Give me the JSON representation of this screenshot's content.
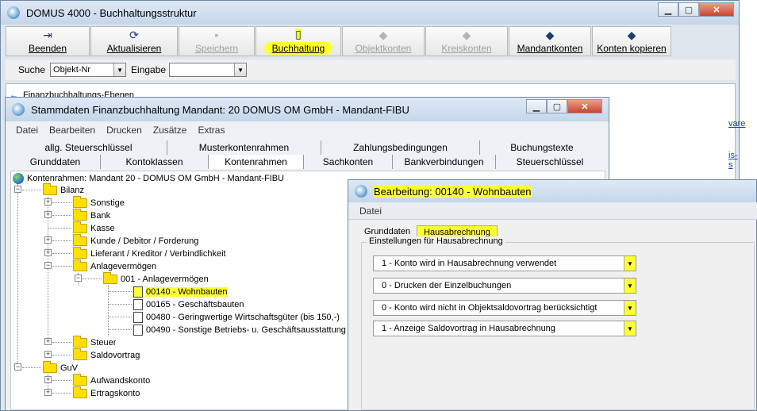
{
  "main": {
    "title": "DOMUS 4000 - Buchhaltungsstruktur",
    "toolbar": [
      {
        "label": "Beenden",
        "icon": "exit-icon",
        "glyph": "⇥"
      },
      {
        "label": "Aktualisieren",
        "icon": "refresh-icon",
        "glyph": "⟳"
      },
      {
        "label": "Speichern",
        "icon": "save-icon",
        "glyph": "▪"
      },
      {
        "label": "Buchhaltung",
        "icon": "book-icon",
        "glyph": "▯"
      },
      {
        "label": "Objektkonten",
        "icon": "eraser-icon",
        "glyph": "◆"
      },
      {
        "label": "Kreiskonten",
        "icon": "eraser-icon",
        "glyph": "◆"
      },
      {
        "label": "Mandantkonten",
        "icon": "eraser-icon",
        "glyph": "◆"
      },
      {
        "label": "Konten kopieren",
        "icon": "eraser-icon",
        "glyph": "◆"
      }
    ],
    "search": {
      "label": "Suche",
      "value": "Objekt-Nr",
      "input_label": "Eingabe",
      "input_value": ""
    },
    "behind_text": "Finanzbuchhaltungs-Ebenen",
    "right_links": [
      "vare",
      "is-s"
    ]
  },
  "stamm": {
    "title": "Stammdaten Finanzbuchhaltung Mandant: 20  DOMUS OM GmbH - Mandant-FIBU",
    "menu": [
      "Datei",
      "Bearbeiten",
      "Drucken",
      "Zusätze",
      "Extras"
    ],
    "tabs_row1": [
      "allg. Steuerschlüssel",
      "Musterkontenrahmen",
      "Zahlungsbedingungen",
      "Buchungstexte"
    ],
    "tabs_row2": [
      "Grunddaten",
      "Kontoklassen",
      "Kontenrahmen",
      "Sachkonten",
      "Bankverbindungen",
      "Steuerschlüssel"
    ],
    "tree": {
      "root": "Kontenrahmen: Mandant 20 - DOMUS OM GmbH - Mandant-FIBU",
      "bilanz": "Bilanz",
      "b_items": [
        "Sonstige",
        "Bank",
        "Kasse",
        "Kunde / Debitor / Forderung",
        "Lieferant / Kreditor / Verbindlichkeit",
        "Anlagevermögen"
      ],
      "sub": "001 - Anlagevermögen",
      "accounts": [
        "00140 - Wohnbauten",
        "00165 - Geschäftsbauten",
        "00480 - Geringwertige Wirtschaftsgüter (bis 150,-)",
        "00490 - Sonstige Betriebs- u. Geschäftsausstattung"
      ],
      "b_items2": [
        "Steuer",
        "Saldovortrag"
      ],
      "guv": "GuV",
      "g_items": [
        "Aufwandskonto",
        "Ertragskonto"
      ]
    }
  },
  "bearb": {
    "title": "Bearbeitung: 00140 - Wohnbauten",
    "menu": [
      "Datei"
    ],
    "tabs": [
      "Grunddaten",
      "Hausabrechnung"
    ],
    "group": "Einstellungen für Hausabrechnung",
    "options": [
      "1 - Konto wird in Hausabrechnung verwendet",
      "0 - Drucken der Einzelbuchungen",
      "0 - Konto wird nicht in Objektsaldovortrag berücksichtigt",
      "1 - Anzeige Saldovortrag in Hausabrechnung"
    ]
  },
  "colors": {
    "highlight": "#ffff33",
    "titlebar": "#c5d6ea"
  }
}
